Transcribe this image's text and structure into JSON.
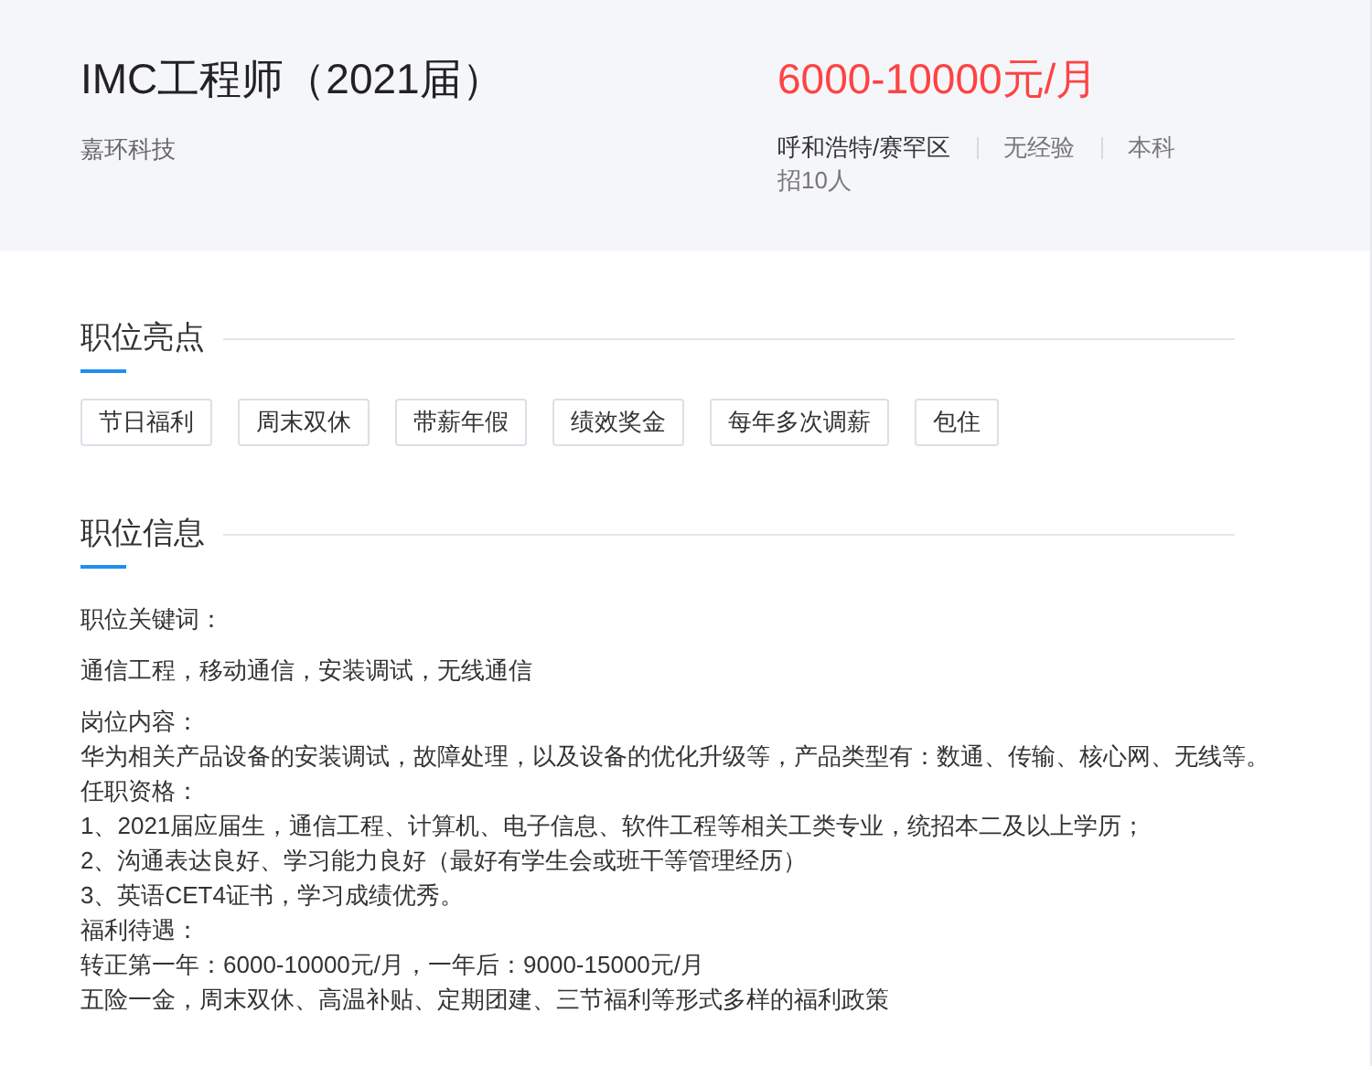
{
  "job": {
    "title": "IMC工程师（2021届）",
    "company": "嘉环科技",
    "salary": "6000-10000元/月",
    "location": "呼和浩特/赛罕区",
    "experience": "无经验",
    "education": "本科",
    "headcount": "招10人"
  },
  "highlights": {
    "title": "职位亮点",
    "tags": [
      "节日福利",
      "周末双休",
      "带薪年假",
      "绩效奖金",
      "每年多次调薪",
      "包住"
    ]
  },
  "info": {
    "title": "职位信息",
    "paragraphs": [
      {
        "lines": [
          "职位关键词："
        ]
      },
      {
        "lines": [
          "通信工程，移动通信，安装调试，无线通信"
        ]
      },
      {
        "lines": [
          "岗位内容：",
          "华为相关产品设备的安装调试，故障处理，以及设备的优化升级等，产品类型有：数通、传输、核心网、无线等。",
          "任职资格：",
          "1、2021届应届生，通信工程、计算机、电子信息、软件工程等相关工类专业，统招本二及以上学历；",
          "2、沟通表达良好、学习能力良好（最好有学生会或班干等管理经历）",
          "3、英语CET4证书，学习成绩优秀。",
          "福利待遇：",
          "转正第一年：6000-10000元/月，一年后：9000-15000元/月",
          "五险一金，周末双休、高温补贴、定期团建、三节福利等形式多样的福利政策"
        ]
      }
    ]
  }
}
